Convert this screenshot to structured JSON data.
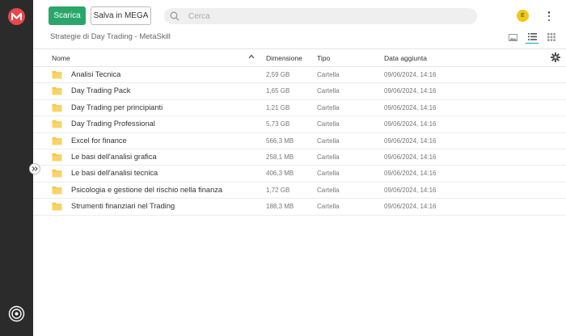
{
  "toolbar": {
    "download_label": "Scarica",
    "save_label": "Salva in MEGA"
  },
  "search": {
    "placeholder": "Cerca"
  },
  "user": {
    "avatar_letter": "E"
  },
  "breadcrumb": "Strategie di Day Trading - MetaSkill",
  "colors": {
    "accent": "#2ba66a",
    "brand": "#e8474b",
    "sidebar": "#2b2b2b",
    "avatar": "#f2c814",
    "folder": "#f5c84c"
  },
  "table": {
    "headers": {
      "name": "Nome",
      "size": "Dimensione",
      "type": "Tipo",
      "date": "Data aggiunta"
    },
    "rows": [
      {
        "name": "Analisi Tecnica",
        "size": "2,59 GB",
        "type": "Cartella",
        "date": "09/06/2024, 14:16"
      },
      {
        "name": "Day Trading Pack",
        "size": "1,65 GB",
        "type": "Cartella",
        "date": "09/06/2024, 14:16"
      },
      {
        "name": "Day Trading per principianti",
        "size": "1,21 GB",
        "type": "Cartella",
        "date": "09/06/2024, 14:16"
      },
      {
        "name": "Day Trading Professional",
        "size": "5,73 GB",
        "type": "Cartella",
        "date": "09/06/2024, 14:16"
      },
      {
        "name": "Excel for finance",
        "size": "566,3 MB",
        "type": "Cartella",
        "date": "09/06/2024, 14:16"
      },
      {
        "name": "Le basi dell'analisi grafica",
        "size": "258,1 MB",
        "type": "Cartella",
        "date": "09/06/2024, 14:16"
      },
      {
        "name": "Le basi dell'analisi tecnica",
        "size": "406,3 MB",
        "type": "Cartella",
        "date": "09/06/2024, 14:16"
      },
      {
        "name": "Psicologia e gestione del rischio nella finanza",
        "size": "1,72 GB",
        "type": "Cartella",
        "date": "09/06/2024, 14:16"
      },
      {
        "name": "Strumenti finanziari nel Trading",
        "size": "188,3 MB",
        "type": "Cartella",
        "date": "09/06/2024, 14:16"
      }
    ]
  }
}
